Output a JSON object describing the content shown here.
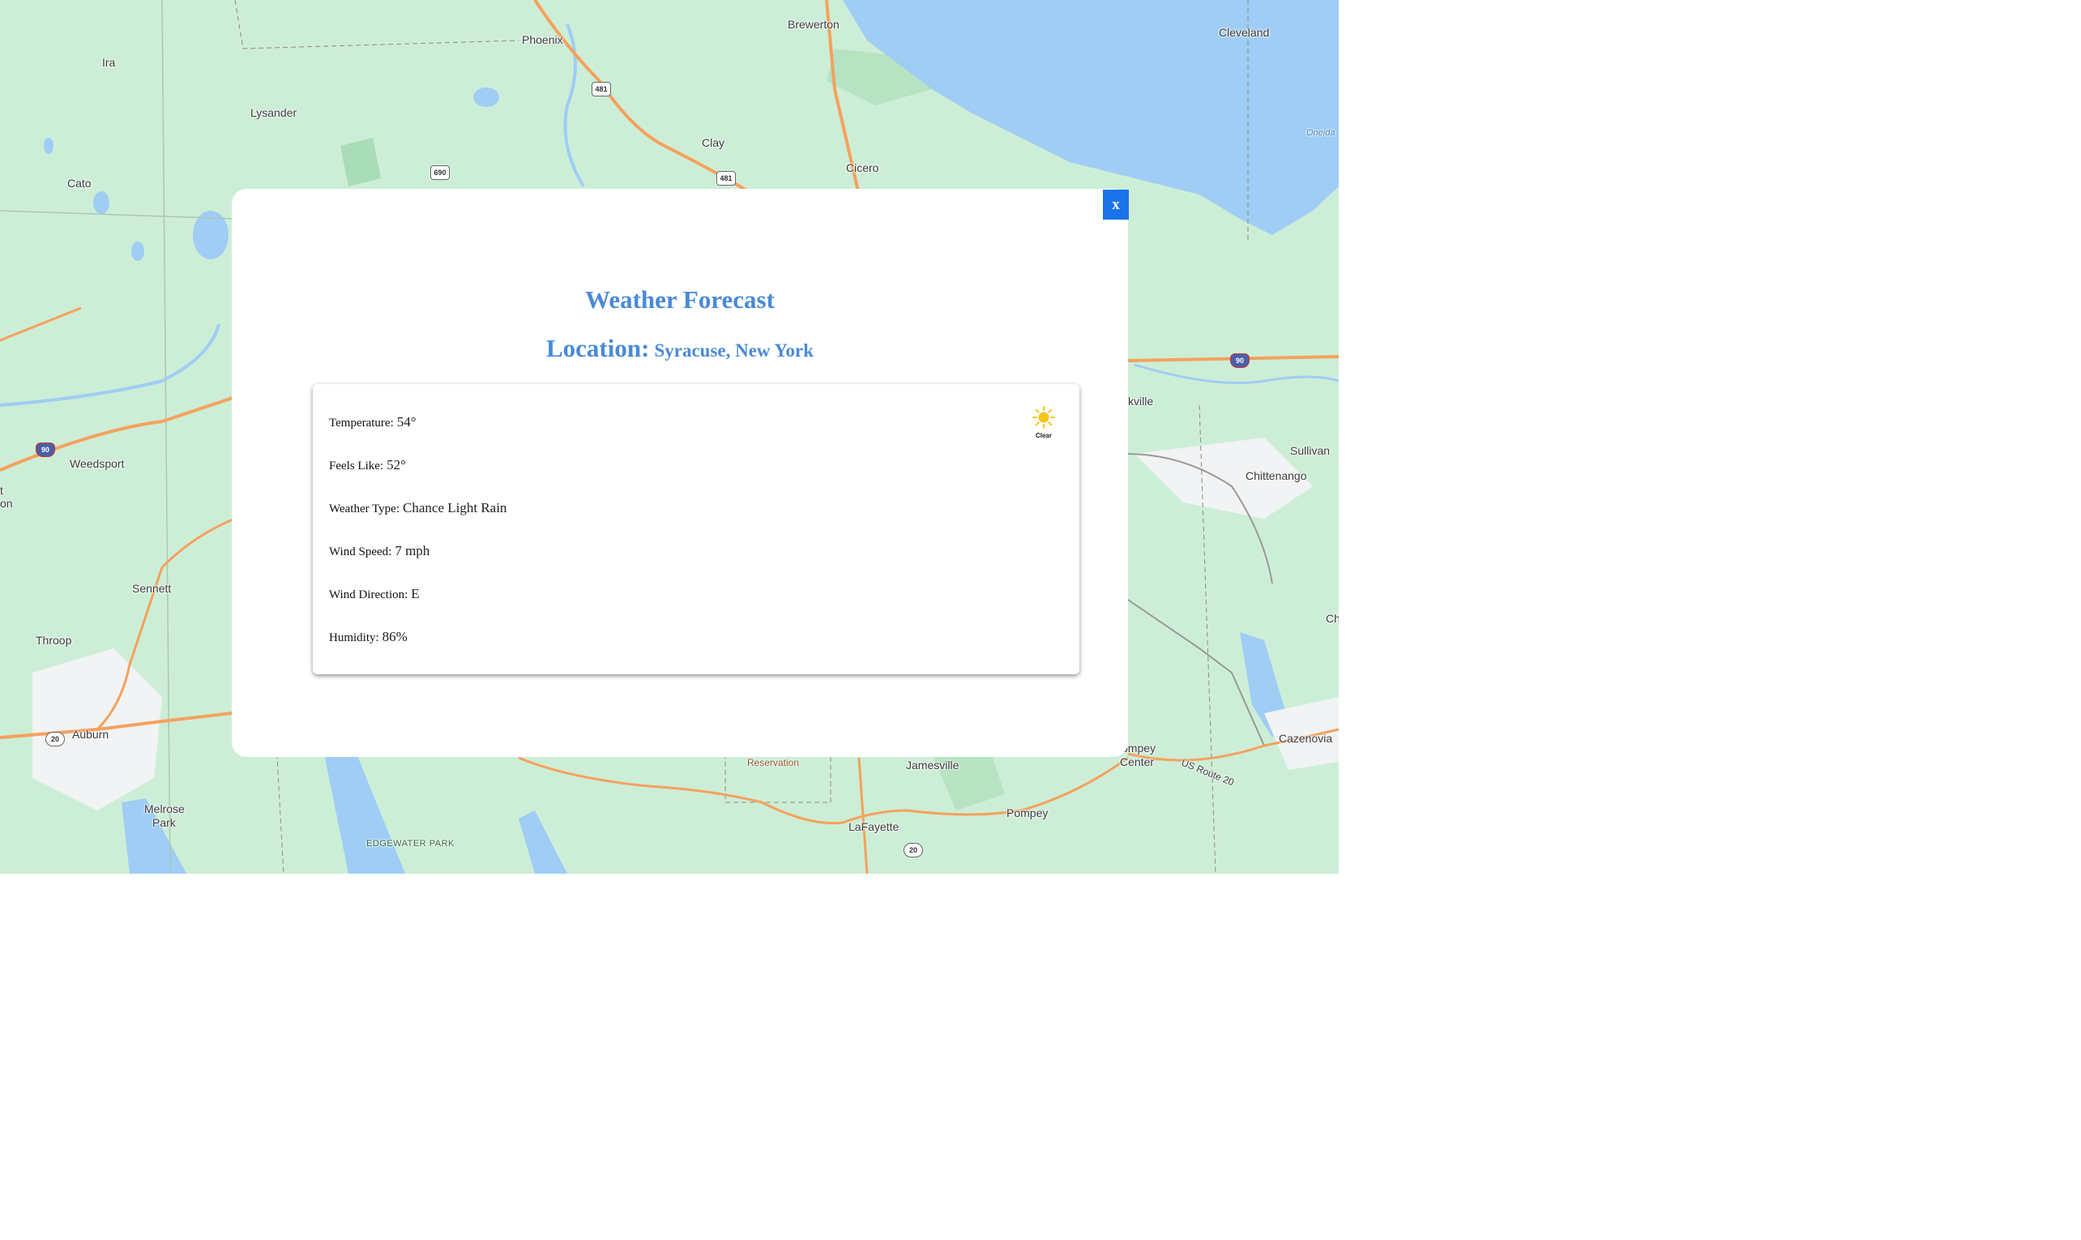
{
  "map": {
    "places": {
      "brewerton": "Brewerton",
      "cleveland": "Cleveland",
      "phoenix": "Phoenix",
      "ira": "Ira",
      "lysander": "Lysander",
      "clay": "Clay",
      "cicero": "Cicero",
      "cato": "Cato",
      "oneida": "Oneida",
      "kville": "kville",
      "sullivan": "Sullivan",
      "chittenango": "Chittenango",
      "weedsport": "Weedsport",
      "t_fragment": "t",
      "on_fragment": "on",
      "sennett": "Sennett",
      "throop": "Throop",
      "auburn": "Auburn",
      "ch_fragment": "Ch",
      "cazenovia": "Cazenovia",
      "ompey_center_1": "ompey",
      "ompey_center_2": "Center",
      "us_route_20": "US Route 20",
      "reservation": "Reservation",
      "jamesville": "Jamesville",
      "pompey": "Pompey",
      "lafayette": "LaFayette",
      "melrose_1": "Melrose",
      "melrose_2": "Park",
      "edgewater_park": "EDGEWATER PARK"
    },
    "shields": {
      "s481_a": "481",
      "s481_b": "481",
      "s690": "690",
      "s90_left": "90",
      "s90_right": "90",
      "s20_left": "20",
      "s20_bottom": "20"
    },
    "colors": {
      "land": "#cdeed6",
      "water": "#9fcdf5",
      "road": "#f5a15e",
      "urban": "#f1f3f4"
    }
  },
  "modal": {
    "close_label": "x",
    "title": "Weather Forecast",
    "location_label": "Location:",
    "location_value": "Syracuse, New York",
    "accent": "#4a8ad6",
    "icon": "sun-icon",
    "icon_caption": "Clear",
    "rows": {
      "temperature": {
        "label": "Temperature:",
        "value": "54°"
      },
      "feels_like": {
        "label": "Feels Like:",
        "value": "52°"
      },
      "weather_type": {
        "label": "Weather Type:",
        "value": "Chance Light Rain"
      },
      "wind_speed": {
        "label": "Wind Speed:",
        "value": "7 mph"
      },
      "wind_direction": {
        "label": "Wind Direction:",
        "value": "E"
      },
      "humidity": {
        "label": "Humidity:",
        "value": "86%"
      }
    }
  }
}
